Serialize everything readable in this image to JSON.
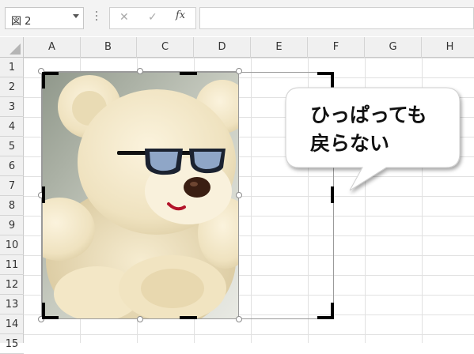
{
  "formula_bar": {
    "name_box": "図 2",
    "cancel_symbol": "✕",
    "enter_symbol": "✓",
    "fx_label": "fx",
    "formula": ""
  },
  "columns": [
    "A",
    "B",
    "C",
    "D",
    "E",
    "F",
    "G",
    "H"
  ],
  "rows": [
    "1",
    "2",
    "3",
    "4",
    "5",
    "6",
    "7",
    "8",
    "9",
    "10",
    "11",
    "12",
    "13",
    "14",
    "15"
  ],
  "callout": {
    "line1": "ひっぱっても",
    "line2": "戻らない"
  },
  "picture": {
    "subject": "teddy bear with sunglasses"
  }
}
